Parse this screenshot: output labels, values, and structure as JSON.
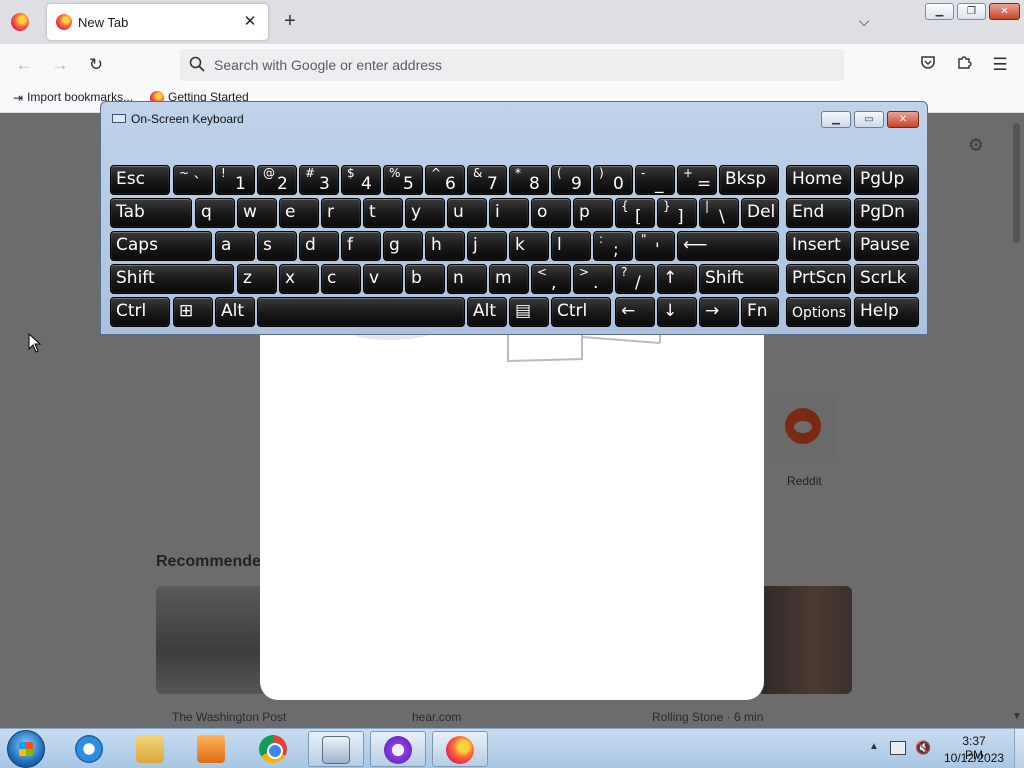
{
  "browser": {
    "tab": {
      "title": "New Tab",
      "close": "✕"
    },
    "new_tab": "+",
    "tab_list": "⌵",
    "window_controls": {
      "minimize": "▁",
      "maximize": "❐",
      "close": "✕"
    },
    "nav": {
      "back": "←",
      "forward": "→",
      "reload": "↻"
    },
    "address_bar": {
      "placeholder": "Search with Google or enter address",
      "value": ""
    },
    "toolbar": {
      "menu": "☰"
    },
    "bookmarks": [
      {
        "label": "Import bookmarks..."
      },
      {
        "label": "Getting Started"
      }
    ]
  },
  "page": {
    "settings_icon": "⚙",
    "shortcut_reddit": {
      "label": "Reddit"
    },
    "recommended_heading": "Recommended by Pocket",
    "cards": [
      {
        "source": "The Washington Post"
      },
      {
        "source": "hear.com"
      },
      {
        "source": "Rolling Stone · 6 min"
      }
    ]
  },
  "osk": {
    "title": "On-Screen Keyboard",
    "controls": {
      "minimize": "▁",
      "maximize": "▭",
      "close": "✕"
    },
    "rows": [
      [
        {
          "l": "Esc"
        },
        {
          "t": "~",
          "b": "`"
        },
        {
          "t": "!",
          "b": "1"
        },
        {
          "t": "@",
          "b": "2"
        },
        {
          "t": "#",
          "b": "3"
        },
        {
          "t": "$",
          "b": "4"
        },
        {
          "t": "%",
          "b": "5"
        },
        {
          "t": "^",
          "b": "6"
        },
        {
          "t": "&",
          "b": "7"
        },
        {
          "t": "*",
          "b": "8"
        },
        {
          "t": "(",
          "b": "9"
        },
        {
          "t": ")",
          "b": "0"
        },
        {
          "t": "-",
          "b": "_"
        },
        {
          "t": "+",
          "b": "="
        },
        {
          "l": "Bksp"
        },
        {
          "l": "Home"
        },
        {
          "l": "PgUp"
        }
      ],
      [
        {
          "l": "Tab"
        },
        {
          "l": "q"
        },
        {
          "l": "w"
        },
        {
          "l": "e"
        },
        {
          "l": "r"
        },
        {
          "l": "t"
        },
        {
          "l": "y"
        },
        {
          "l": "u"
        },
        {
          "l": "i"
        },
        {
          "l": "o"
        },
        {
          "l": "p"
        },
        {
          "t": "{",
          "b": "["
        },
        {
          "t": "}",
          "b": "]"
        },
        {
          "t": "|",
          "b": "\\"
        },
        {
          "l": "Del"
        },
        {
          "l": "End"
        },
        {
          "l": "PgDn"
        }
      ],
      [
        {
          "l": "Caps"
        },
        {
          "l": "a"
        },
        {
          "l": "s"
        },
        {
          "l": "d"
        },
        {
          "l": "f"
        },
        {
          "l": "g"
        },
        {
          "l": "h"
        },
        {
          "l": "j"
        },
        {
          "l": "k"
        },
        {
          "l": "l"
        },
        {
          "t": ":",
          "b": ";"
        },
        {
          "t": "\"",
          "b": "'"
        },
        {
          "l": "⟵"
        },
        {
          "l": "Insert"
        },
        {
          "l": "Pause"
        }
      ],
      [
        {
          "l": "Shift"
        },
        {
          "l": "z"
        },
        {
          "l": "x"
        },
        {
          "l": "c"
        },
        {
          "l": "v"
        },
        {
          "l": "b"
        },
        {
          "l": "n"
        },
        {
          "l": "m"
        },
        {
          "t": "<",
          "b": ","
        },
        {
          "t": ">",
          "b": "."
        },
        {
          "t": "?",
          "b": "/"
        },
        {
          "l": "↑"
        },
        {
          "l": "Shift"
        },
        {
          "l": "PrtScn"
        },
        {
          "l": "ScrLk"
        }
      ],
      [
        {
          "l": "Ctrl"
        },
        {
          "l": "⊞"
        },
        {
          "l": "Alt"
        },
        {
          "l": ""
        },
        {
          "l": "Alt"
        },
        {
          "l": "▤"
        },
        {
          "l": "Ctrl"
        },
        {
          "l": "←"
        },
        {
          "l": "↓"
        },
        {
          "l": "→"
        },
        {
          "l": "Fn"
        },
        {
          "l": "Options",
          "small": true
        },
        {
          "l": "Help"
        }
      ]
    ]
  },
  "taskbar": {
    "apps": [
      "Internet Explorer",
      "Windows Explorer",
      "Windows Media Player",
      "Google Chrome",
      "On-Screen Keyboard",
      "App",
      "Firefox"
    ],
    "tray_arrow": "▲",
    "volume": "🔇",
    "clock": {
      "time": "3:37 PM",
      "date": "10/12/2023"
    }
  }
}
